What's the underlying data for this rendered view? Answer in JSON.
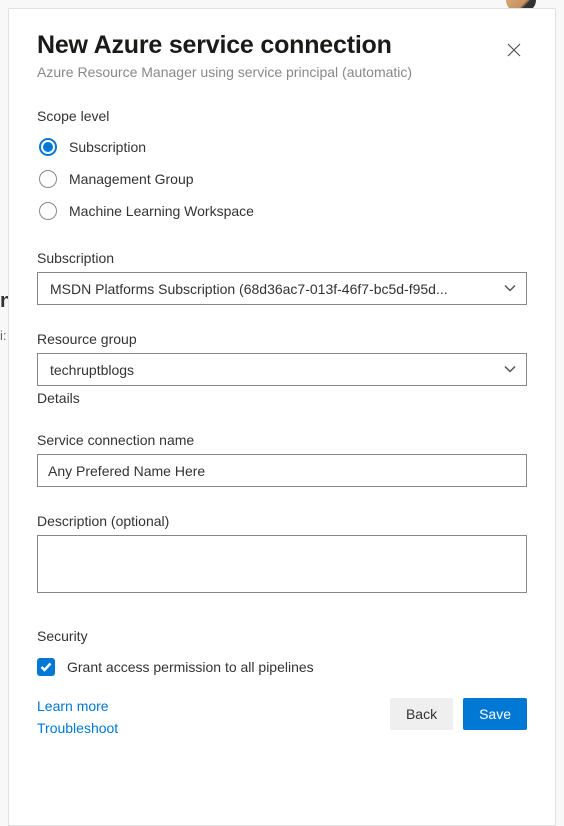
{
  "header": {
    "title": "New Azure service connection",
    "subtitle": "Azure Resource Manager using service principal (automatic)"
  },
  "scope": {
    "label": "Scope level",
    "options": [
      {
        "label": "Subscription",
        "checked": true
      },
      {
        "label": "Management Group",
        "checked": false
      },
      {
        "label": "Machine Learning Workspace",
        "checked": false
      }
    ]
  },
  "subscription": {
    "label": "Subscription",
    "value": "MSDN Platforms Subscription (68d36ac7-013f-46f7-bc5d-f95d..."
  },
  "resource_group": {
    "label": "Resource group",
    "value": "techruptblogs",
    "details_label": "Details"
  },
  "service_connection_name": {
    "label": "Service connection name",
    "value": "Any Prefered Name Here"
  },
  "description": {
    "label": "Description (optional)",
    "value": ""
  },
  "security": {
    "label": "Security",
    "checkbox_label": "Grant access permission to all pipelines",
    "checked": true
  },
  "footer": {
    "learn_more": "Learn more",
    "troubleshoot": "Troubleshoot",
    "back": "Back",
    "save": "Save"
  }
}
